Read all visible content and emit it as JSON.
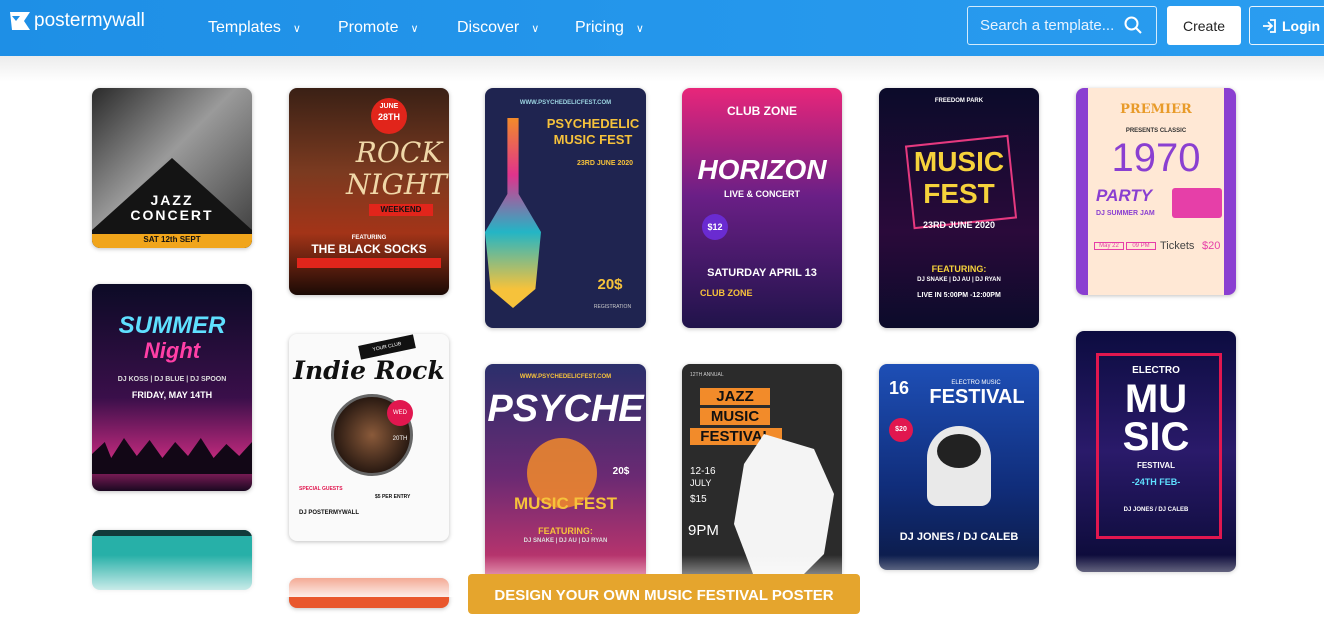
{
  "header": {
    "brand": "postermywall",
    "nav": [
      {
        "label": "Templates"
      },
      {
        "label": "Promote"
      },
      {
        "label": "Discover"
      },
      {
        "label": "Pricing"
      }
    ],
    "search_placeholder": "Search a template...",
    "create_label": "Create",
    "login_label": "Login",
    "colors": {
      "bar": "#1e8fe6",
      "cta": "#e5a52d"
    }
  },
  "posters": {
    "jazz": {
      "title": "JAZZ",
      "title2": "CONCERT",
      "date": "SAT 12th SEPT"
    },
    "rock": {
      "badge1": "JUNE",
      "badge2": "28TH",
      "title": "ROCK",
      "title2": "NIGHT",
      "tag": "WEEKEND",
      "featuring": "FEATURING",
      "band": "THE BLACK SOCKS"
    },
    "psychedelic": {
      "url": "WWW.PSYCHEDELICFEST.COM",
      "title": "PSYCHEDELIC",
      "title2": "MUSIC FEST",
      "date": "23RD JUNE 2020",
      "price": "20$",
      "reg": "REGISTRATION"
    },
    "horizon": {
      "club": "CLUB ZONE",
      "title": "HORIZON",
      "sub": "LIVE & CONCERT",
      "price": "$12",
      "date": "SATURDAY APRIL 13",
      "club2": "CLUB ZONE"
    },
    "musicfest": {
      "top": "FREEDOM PARK",
      "title": "MUSIC",
      "title2": "FEST",
      "date": "23RD JUNE 2020",
      "feat": "FEATURING:",
      "djs": "DJ SNAKE | DJ AU | DJ RYAN",
      "time": "LIVE IN 5:00PM -12:00PM"
    },
    "party": {
      "brand": "PREMIER",
      "presents": "PRESENTS CLASSIC",
      "year": "1970",
      "title": "PARTY",
      "dj": "DJ SUMMER JAM",
      "d1": "May 22",
      "d2": "09 PM",
      "tickets": "Tickets",
      "price": "$20"
    },
    "summer": {
      "title": "SUMMER",
      "title2": "Night",
      "djs": "DJ KOSS | DJ BLUE | DJ SPOON",
      "date": "FRIDAY, MAY 14TH"
    },
    "indie": {
      "ribbon": "YOUR CLUB PRESENTS",
      "title": "Indie Rock",
      "badge": "WED 20TH",
      "guests": "SPECIAL GUESTS",
      "dj": "DJ POSTERMYWALL",
      "entry": "$5 PER ENTRY"
    },
    "psyche": {
      "url": "WWW.PSYCHEDELICFEST.COM",
      "title": "PSYCHE",
      "fest": "MUSIC FEST",
      "price": "20$",
      "feat": "FEATURING:",
      "djs": "DJ SNAKE | DJ AU | DJ RYAN"
    },
    "jazzfest": {
      "top": "12TH ANNUAL",
      "title": "JAZZ",
      "title2": "MUSIC",
      "title3": "FESTIVAL",
      "date": "12-16",
      "month": "JULY",
      "price": "$15",
      "time": "9PM"
    },
    "electro": {
      "day": "16",
      "top": "ELECTRO MUSIC",
      "title": "FESTIVAL",
      "price": "$20",
      "djs": "DJ JONES / DJ CALEB"
    },
    "emusic": {
      "top": "ELECTRO",
      "title": "MU",
      "title2": "SIC",
      "sub": "FESTIVAL",
      "date": "-24TH FEB-",
      "djs": "DJ JONES / DJ CALEB"
    }
  },
  "cta_label": "DESIGN YOUR OWN MUSIC FESTIVAL POSTER"
}
